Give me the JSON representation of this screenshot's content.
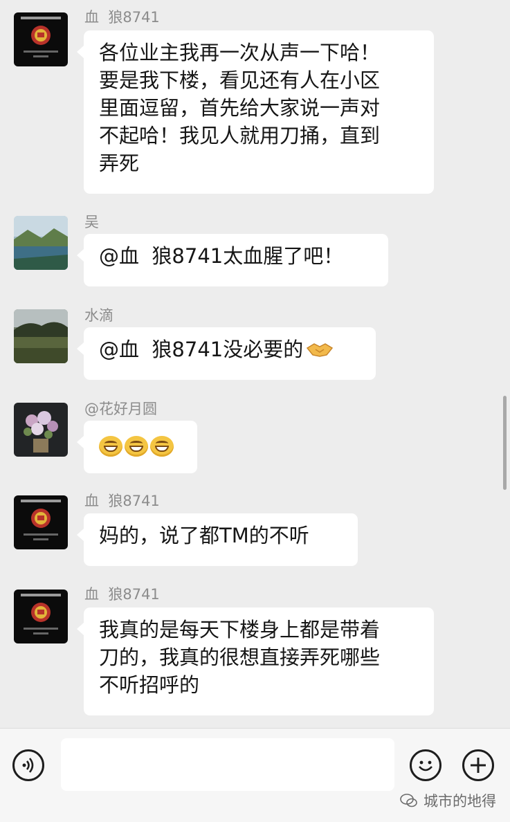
{
  "messages": [
    {
      "sender": "血  狼8741",
      "avatar": "police-emblem",
      "lines": [
        "各位业主我再一次从声一下哈！",
        "要是我下楼，看见还有人在小区",
        "里面逗留，首先给大家说一声对",
        "不起哈！我见人就用刀捅，直到",
        "弄死"
      ]
    },
    {
      "sender": "吴",
      "avatar": "lake-landscape",
      "lines": [
        "@血  狼8741太血腥了吧！"
      ]
    },
    {
      "sender": "水滴",
      "avatar": "field-landscape",
      "lines": [
        "@血  狼8741没必要的"
      ],
      "trailing_emoji": "handshake-emoji"
    },
    {
      "sender": "@花好月圆",
      "avatar": "flower-bouquet",
      "lines": [
        ""
      ],
      "emojis": [
        "grin-emoji",
        "grin-emoji",
        "grin-emoji"
      ]
    },
    {
      "sender": "血  狼8741",
      "avatar": "police-emblem",
      "lines": [
        "妈的，说了都TM的不听"
      ]
    },
    {
      "sender": "血  狼8741",
      "avatar": "police-emblem",
      "lines": [
        "我真的是每天下楼身上都是带着",
        "刀的，我真的很想直接弄死哪些",
        "不听招呼的"
      ]
    }
  ],
  "bottom_bar": {
    "input_value": "",
    "watermark": "城市的地得"
  },
  "colors": {
    "background": "#ededed",
    "bubble": "#ffffff",
    "sender_text": "#8c8c8c"
  }
}
